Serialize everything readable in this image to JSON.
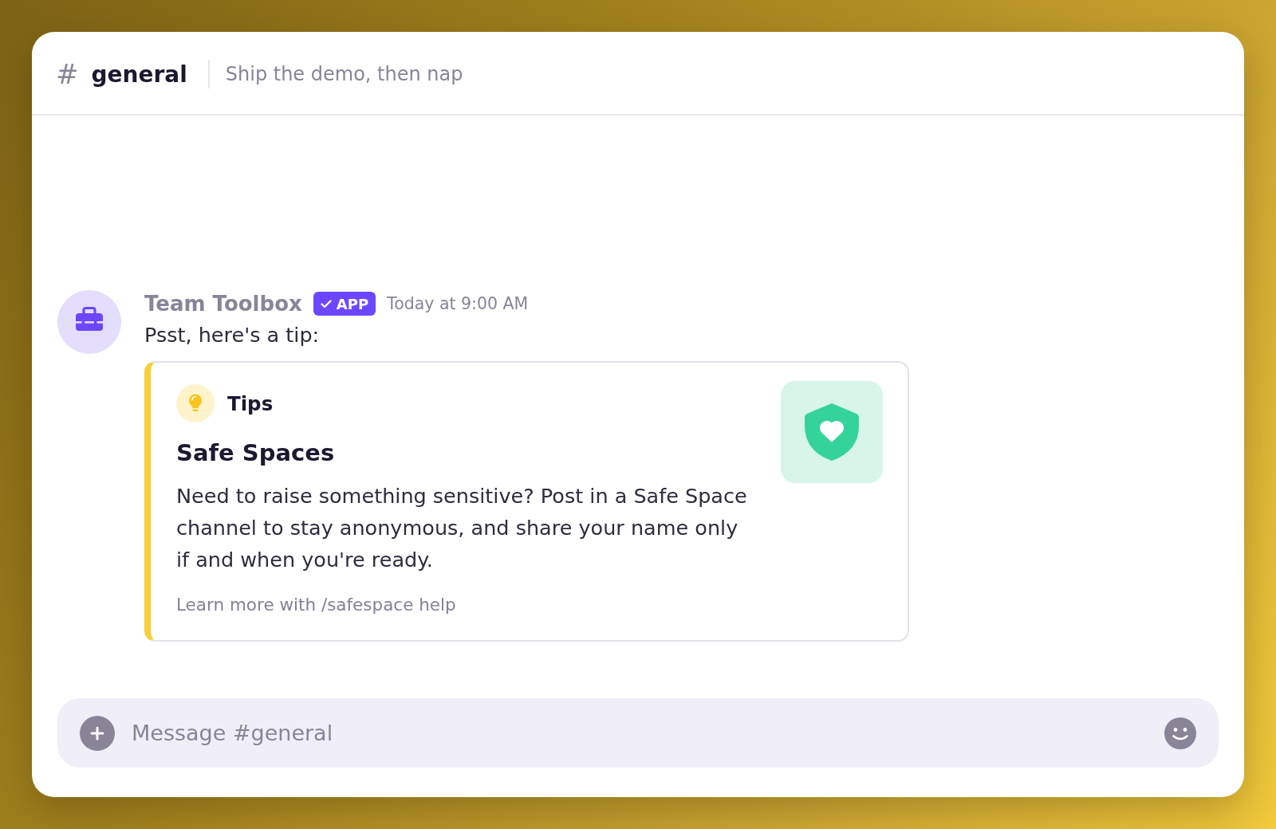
{
  "channel": {
    "hash": "#",
    "name": "general",
    "topic": "Ship the demo, then nap"
  },
  "messages": [
    {
      "author": "Team Toolbox",
      "badge": {
        "label": "APP",
        "verified": true
      },
      "time": "Today at 9:00 AM",
      "text": "Psst, here's a tip:",
      "card": {
        "category": "Tips",
        "title": "Safe Spaces",
        "body": "Need to raise something sensitive? Post in a Safe Space channel to stay anonymous, and share your name only if and when you're ready.",
        "footer": "Learn more with /safespace help"
      }
    }
  ],
  "composer": {
    "placeholder": "Message #general"
  }
}
